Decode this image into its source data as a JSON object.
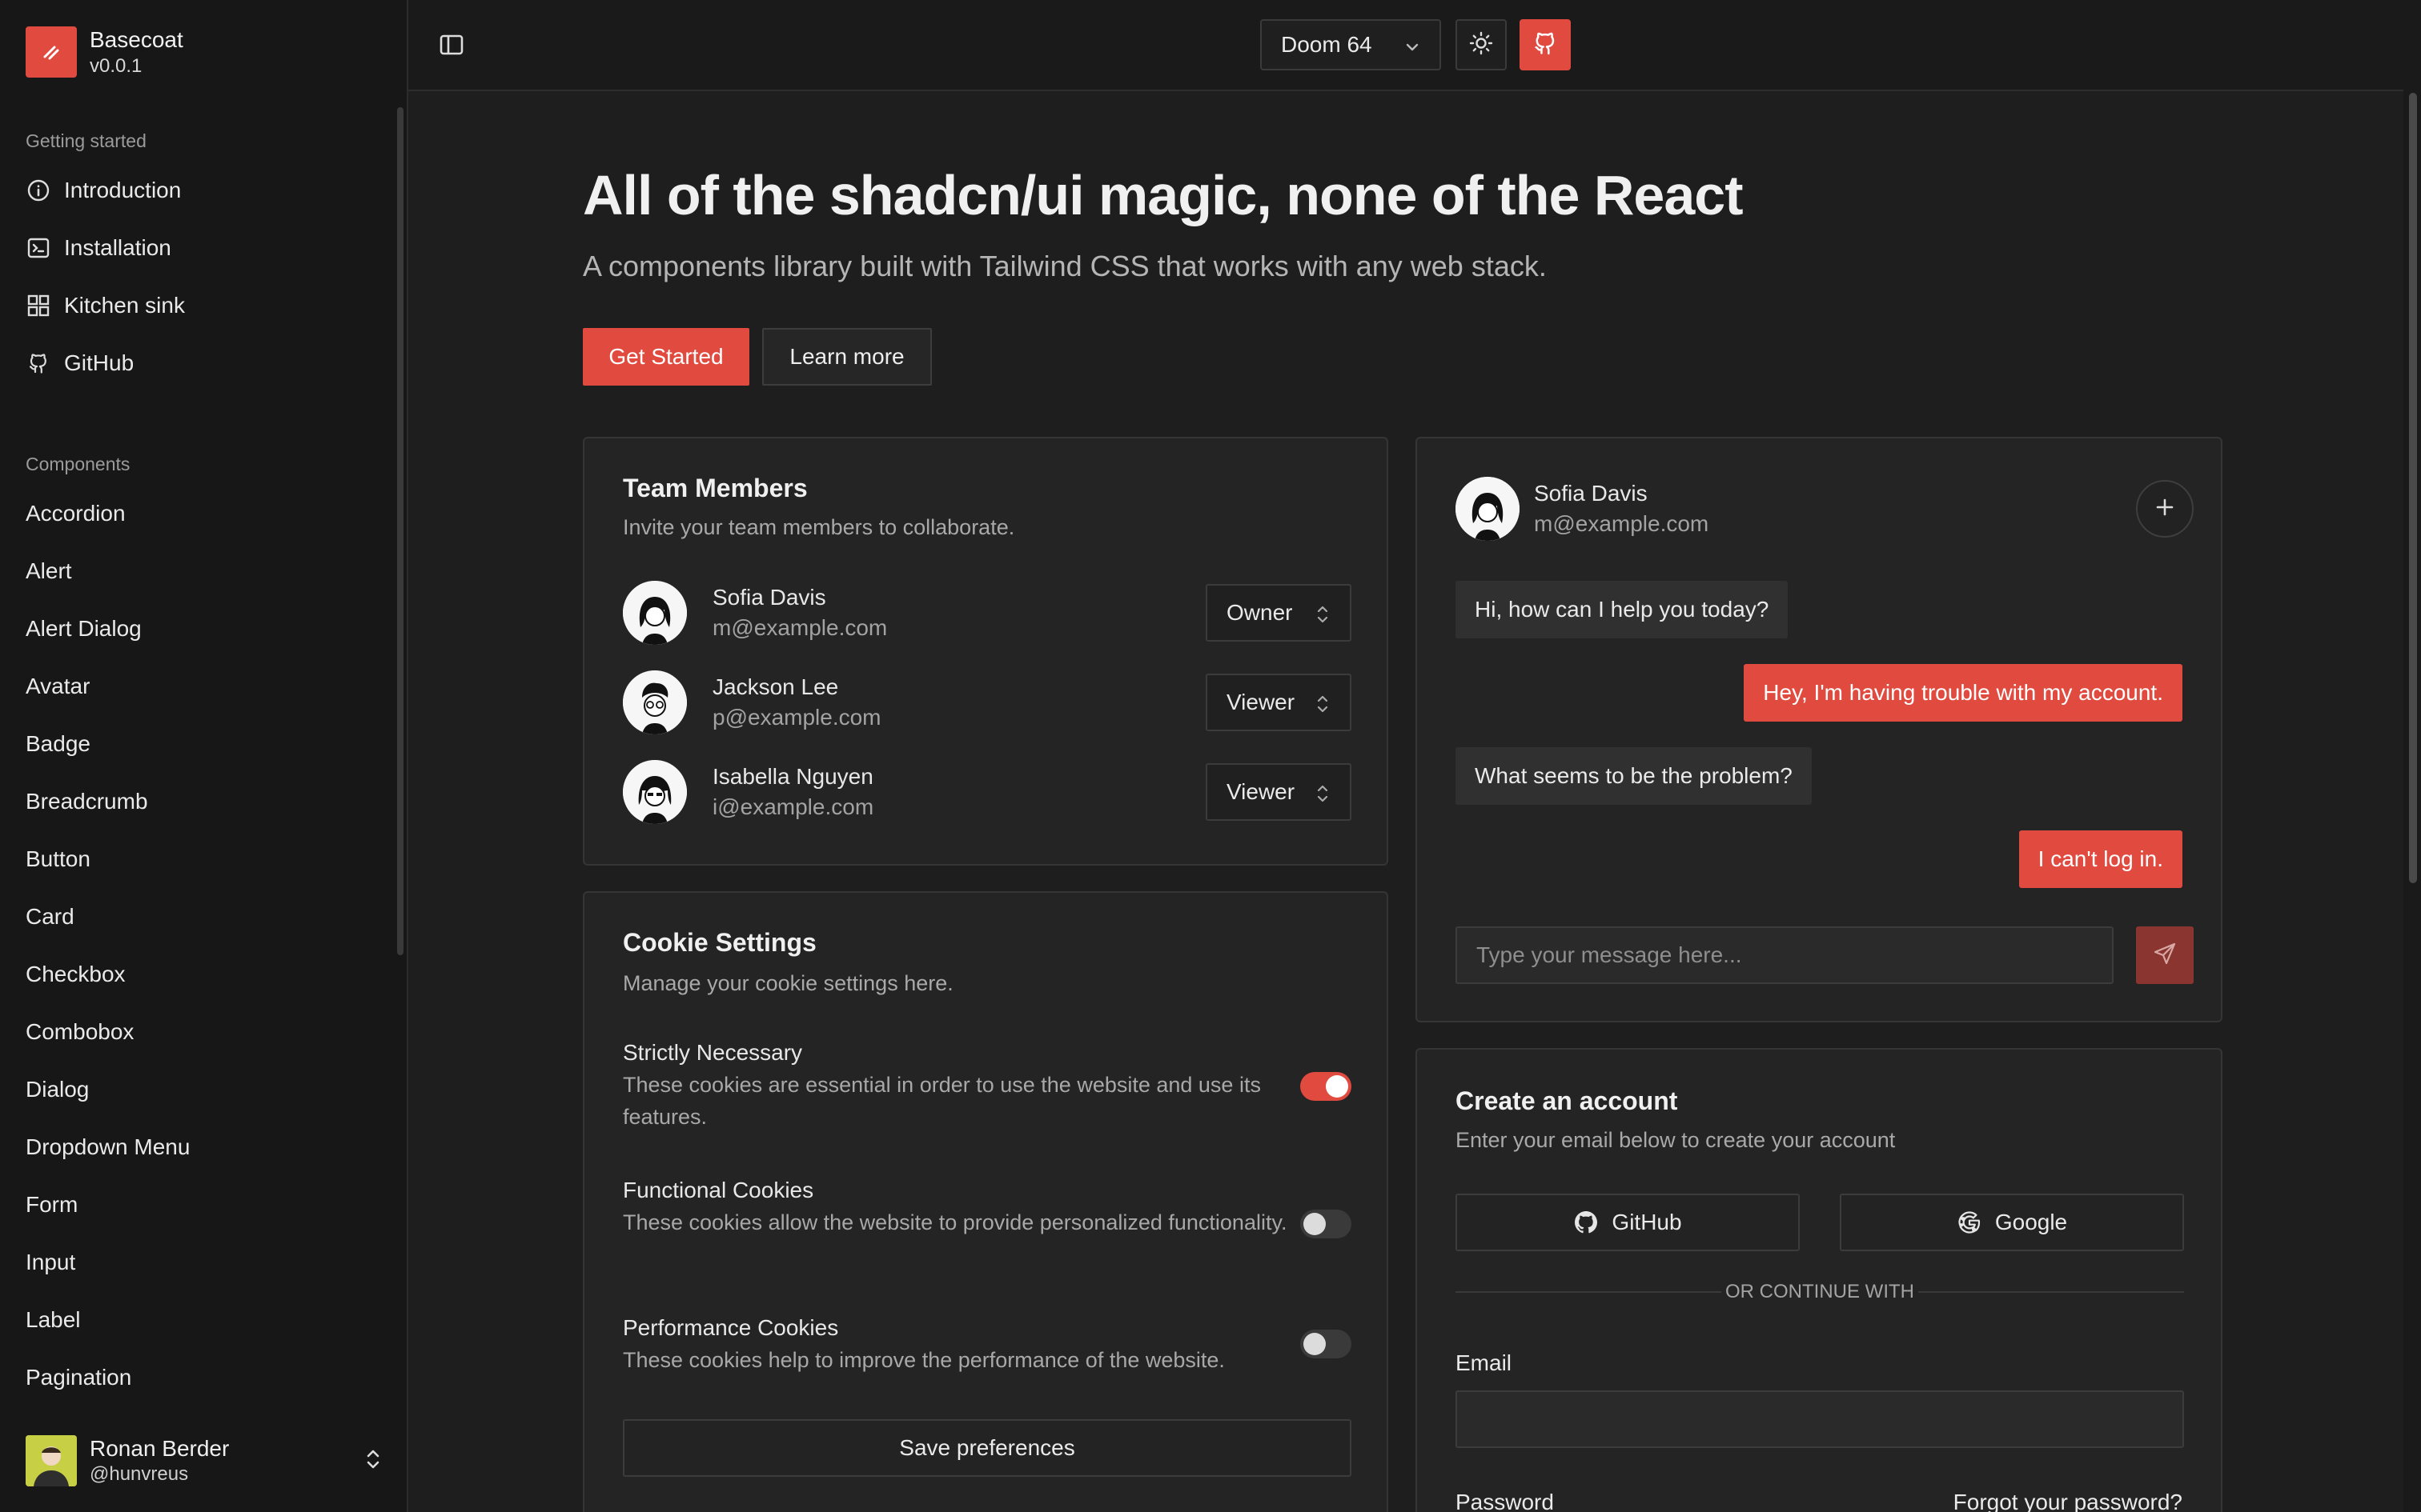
{
  "brand": {
    "name": "Basecoat",
    "version": "v0.0.1"
  },
  "sidebar": {
    "groups": [
      {
        "label": "Getting started",
        "items": [
          "Introduction",
          "Installation",
          "Kitchen sink",
          "GitHub"
        ]
      },
      {
        "label": "Components",
        "items": [
          "Accordion",
          "Alert",
          "Alert Dialog",
          "Avatar",
          "Badge",
          "Breadcrumb",
          "Button",
          "Card",
          "Checkbox",
          "Combobox",
          "Dialog",
          "Dropdown Menu",
          "Form",
          "Input",
          "Label",
          "Pagination"
        ]
      }
    ],
    "user": {
      "name": "Ronan Berder",
      "handle": "@hunvreus"
    }
  },
  "topbar": {
    "theme": "Doom 64"
  },
  "hero": {
    "title": "All of the shadcn/ui magic, none of the React",
    "subtitle": "A components library built with Tailwind CSS that works with any web stack.",
    "primary_label": "Get Started",
    "secondary_label": "Learn more"
  },
  "team": {
    "title": "Team Members",
    "description": "Invite your team members to collaborate.",
    "members": [
      {
        "name": "Sofia Davis",
        "email": "m@example.com",
        "role": "Owner"
      },
      {
        "name": "Jackson Lee",
        "email": "p@example.com",
        "role": "Viewer"
      },
      {
        "name": "Isabella Nguyen",
        "email": "i@example.com",
        "role": "Viewer"
      }
    ]
  },
  "cookies": {
    "title": "Cookie Settings",
    "description": "Manage your cookie settings here.",
    "items": [
      {
        "title": "Strictly Necessary",
        "desc": "These cookies are essential in order to use the website and use its features.",
        "enabled": true
      },
      {
        "title": "Functional Cookies",
        "desc": "These cookies allow the website to provide personalized functionality.",
        "enabled": false
      },
      {
        "title": "Performance Cookies",
        "desc": "These cookies help to improve the performance of the website.",
        "enabled": false
      }
    ],
    "save_label": "Save preferences"
  },
  "chat": {
    "name": "Sofia Davis",
    "email": "m@example.com",
    "messages": [
      {
        "from": "them",
        "text": "Hi, how can I help you today?"
      },
      {
        "from": "me",
        "text": "Hey, I'm having trouble with my account."
      },
      {
        "from": "them",
        "text": "What seems to be the problem?"
      },
      {
        "from": "me",
        "text": "I can't log in."
      }
    ],
    "placeholder": "Type your message here..."
  },
  "account": {
    "title": "Create an account",
    "description": "Enter your email below to create your account",
    "github_label": "GitHub",
    "google_label": "Google",
    "divider": "OR CONTINUE WITH",
    "email_label": "Email",
    "password_label": "Password",
    "forgot_label": "Forgot your password?"
  },
  "colors": {
    "accent": "#e14a3f",
    "background": "#1e1e1e",
    "card": "#242424",
    "sidebar": "#171717"
  }
}
